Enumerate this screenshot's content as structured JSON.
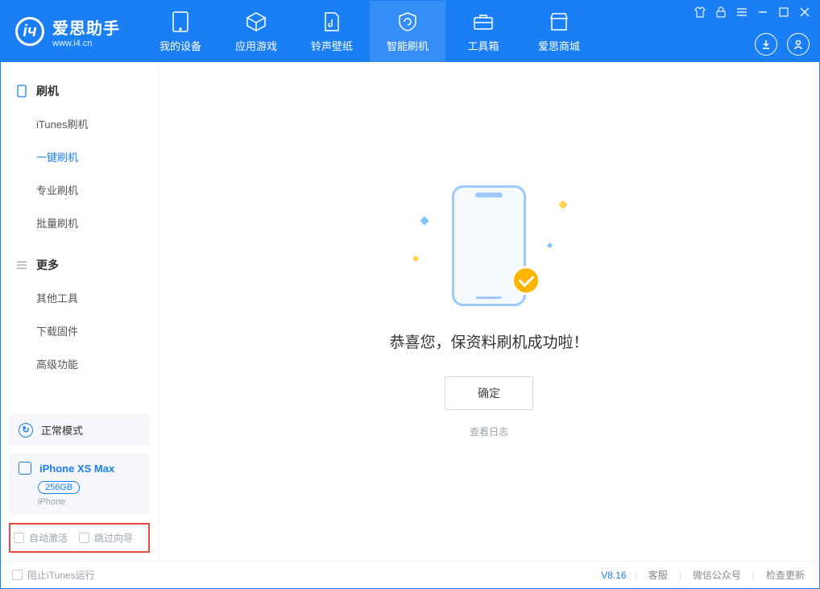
{
  "app": {
    "name": "爱思助手",
    "url": "www.i4.cn"
  },
  "nav": {
    "device": "我的设备",
    "apps": "应用游戏",
    "ring": "铃声壁纸",
    "flash": "智能刷机",
    "tools": "工具箱",
    "store": "爱思商城"
  },
  "sidebar": {
    "group_flash": "刷机",
    "items_flash": {
      "itunes": "iTunes刷机",
      "oneclick": "一键刷机",
      "pro": "专业刷机",
      "batch": "批量刷机"
    },
    "group_more": "更多",
    "items_more": {
      "other": "其他工具",
      "firmware": "下载固件",
      "advanced": "高级功能"
    }
  },
  "device": {
    "mode": "正常模式",
    "name": "iPhone XS Max",
    "capacity": "256GB",
    "type": "iPhone"
  },
  "options": {
    "auto_activate": "自动激活",
    "skip_guide": "跳过向导"
  },
  "main": {
    "success_title": "恭喜您，保资料刷机成功啦！",
    "ok": "确定",
    "view_log": "查看日志"
  },
  "footer": {
    "block_itunes": "阻止iTunes运行",
    "version": "V8.16",
    "support": "客服",
    "wechat": "微信公众号",
    "update": "检查更新"
  }
}
